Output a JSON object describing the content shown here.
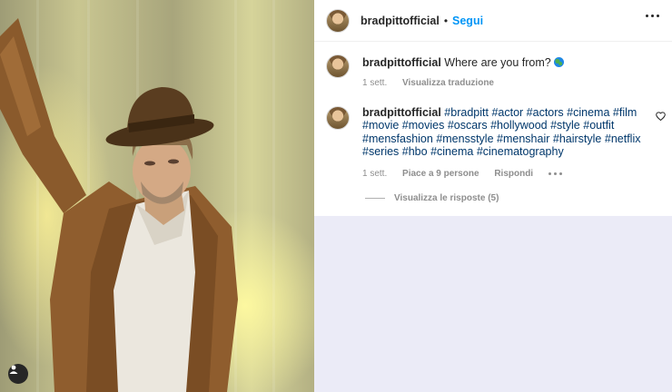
{
  "post": {
    "username": "bradpittofficial",
    "separator": "•",
    "follow_label": "Segui",
    "more_icon": "more-horizontal-icon"
  },
  "photo": {
    "alt_subject": "",
    "user_tag_icon": "user-tag-icon"
  },
  "comments": [
    {
      "username": "bradpittofficial",
      "text": "Where are you from?",
      "emoji_icon": "globe-icon",
      "time": "1 sett.",
      "translate_label": "Visualizza traduzione"
    },
    {
      "username": "bradpittofficial",
      "hashtags": [
        "#bradpitt",
        "#actor",
        "#actors",
        "#cinema",
        "#film",
        "#movie",
        "#movies",
        "#oscars",
        "#hollywood",
        "#style",
        "#outfit",
        "#mensfashion",
        "#mensstyle",
        "#menshair",
        "#hairstyle",
        "#netflix",
        "#series",
        "#hbo",
        "#cinema",
        "#cinematography"
      ],
      "time": "1 sett.",
      "likes_label": "Piace a 9 persone",
      "reply_label": "Rispondi",
      "view_replies_label": "Visualizza le risposte (5)"
    }
  ],
  "colors": {
    "link_blue": "#0095f6",
    "hashtag": "#00376b",
    "muted": "#8e8e8e",
    "background": "#ebebf7"
  }
}
